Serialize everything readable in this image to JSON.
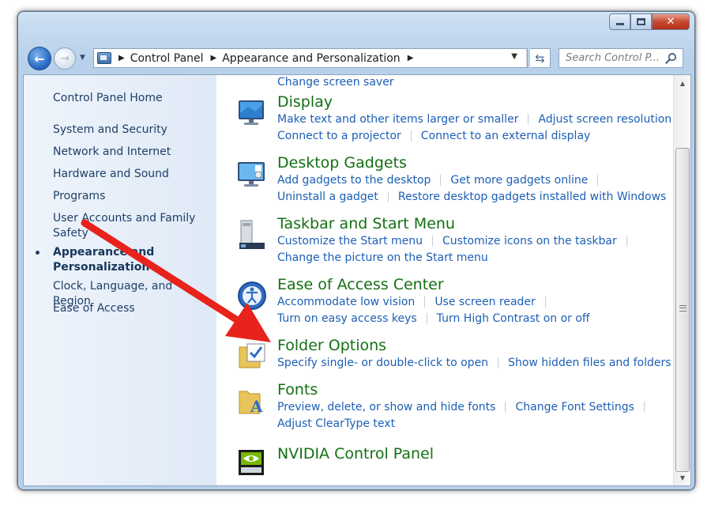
{
  "address_bar": {
    "crumbs": [
      "Control Panel",
      "Appearance and Personalization"
    ]
  },
  "search": {
    "placeholder": "Search Control P..."
  },
  "window_controls": {
    "close_label": "✕"
  },
  "sidebar": {
    "home": "Control Panel Home",
    "items": [
      {
        "label": "System and Security"
      },
      {
        "label": "Network and Internet"
      },
      {
        "label": "Hardware and Sound"
      },
      {
        "label": "Programs"
      },
      {
        "label": "User Accounts and Family",
        "label2": "Safety"
      },
      {
        "label": "Appearance and",
        "label2": "Personalization",
        "current": true
      },
      {
        "label": "Clock, Language, and Region"
      },
      {
        "label": "Ease of Access"
      }
    ]
  },
  "main": {
    "top_link": "Change screen saver",
    "categories": [
      {
        "title": "Display",
        "icon": "display-icon",
        "rows": [
          [
            "Make text and other items larger or smaller",
            "Adjust screen resolution"
          ],
          [
            "Connect to a projector",
            "Connect to an external display"
          ]
        ]
      },
      {
        "title": "Desktop Gadgets",
        "icon": "gadgets-icon",
        "rows": [
          [
            "Add gadgets to the desktop",
            "Get more gadgets online"
          ],
          [
            "Uninstall a gadget",
            "Restore desktop gadgets installed with Windows"
          ]
        ]
      },
      {
        "title": "Taskbar and Start Menu",
        "icon": "taskbar-icon",
        "rows": [
          [
            "Customize the Start menu",
            "Customize icons on the taskbar"
          ],
          [
            "Change the picture on the Start menu"
          ]
        ]
      },
      {
        "title": "Ease of Access Center",
        "icon": "ease-of-access-icon",
        "rows": [
          [
            "Accommodate low vision",
            "Use screen reader"
          ],
          [
            "Turn on easy access keys",
            "Turn High Contrast on or off"
          ]
        ]
      },
      {
        "title": "Folder Options",
        "icon": "folder-options-icon",
        "rows": [
          [
            "Specify single- or double-click to open",
            "Show hidden files and folders"
          ]
        ]
      },
      {
        "title": "Fonts",
        "icon": "fonts-icon",
        "rows": [
          [
            "Preview, delete, or show and hide fonts",
            "Change Font Settings"
          ],
          [
            "Adjust ClearType text"
          ]
        ]
      },
      {
        "title": "NVIDIA Control Panel",
        "icon": "nvidia-icon",
        "rows": []
      }
    ]
  },
  "colors": {
    "link": "#1c5fb5",
    "category_title": "#137013",
    "annotation_arrow": "#e8231b"
  }
}
